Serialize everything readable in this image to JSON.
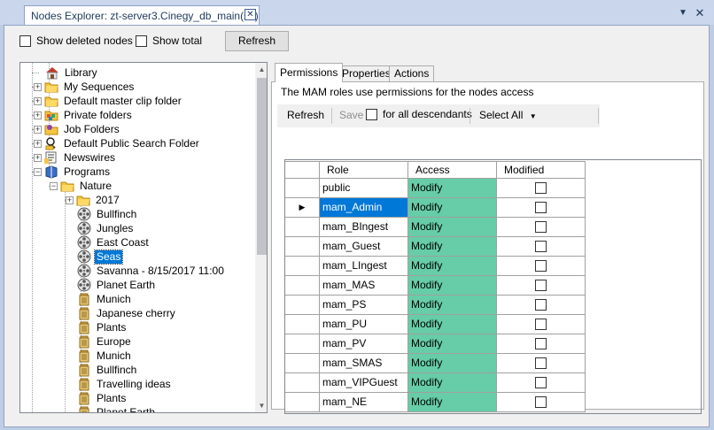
{
  "window": {
    "tab_title": "Nodes Explorer: zt-server3.Cinegy_db_main(sa)",
    "close_glyph": "✕",
    "menu_glyph": "▼",
    "window_close_glyph": "✕"
  },
  "top_bar": {
    "show_deleted_label": "Show deleted nodes",
    "show_total_label": "Show total",
    "refresh_label": "Refresh"
  },
  "tree": {
    "items": [
      {
        "label": "Library",
        "icon": "library-icon"
      },
      {
        "label": "My Sequences",
        "icon": "folder-icon"
      },
      {
        "label": "Default master clip folder",
        "icon": "folder-icon"
      },
      {
        "label": "Private folders",
        "icon": "private-folder-icon"
      },
      {
        "label": "Job Folders",
        "icon": "job-folder-icon"
      },
      {
        "label": "Default Public Search Folder",
        "icon": "search-folder-icon"
      },
      {
        "label": "Newswires",
        "icon": "newswire-icon"
      },
      {
        "label": "Programs",
        "icon": "programs-icon"
      },
      {
        "label": "Nature",
        "icon": "folder-open-icon"
      },
      {
        "label": "2017",
        "icon": "folder-icon"
      },
      {
        "label": "Bullfinch",
        "icon": "film-reel-icon"
      },
      {
        "label": "Jungles",
        "icon": "film-reel-icon"
      },
      {
        "label": "East Coast",
        "icon": "film-reel-icon"
      },
      {
        "label": "Seas",
        "icon": "film-reel-icon"
      },
      {
        "label": "Savanna - 8/15/2017 11:00",
        "icon": "film-reel-icon"
      },
      {
        "label": "Planet Earth",
        "icon": "film-reel-icon"
      },
      {
        "label": "Munich",
        "icon": "bin-icon"
      },
      {
        "label": "Japanese cherry",
        "icon": "bin-icon"
      },
      {
        "label": "Plants",
        "icon": "bin-icon"
      },
      {
        "label": "Europe",
        "icon": "bin-icon"
      },
      {
        "label": "Munich",
        "icon": "bin-icon"
      },
      {
        "label": "Bullfinch",
        "icon": "bin-icon"
      },
      {
        "label": "Travelling ideas",
        "icon": "bin-icon"
      },
      {
        "label": "Plants",
        "icon": "bin-icon"
      },
      {
        "label": "Planet Earth",
        "icon": "bin-icon"
      }
    ],
    "selected": "Seas"
  },
  "tabs": {
    "permissions": "Permissions",
    "properties": "Properties",
    "actions": "Actions"
  },
  "permissions": {
    "description": "The MAM roles use permissions for the nodes access",
    "toolbar": {
      "refresh": "Refresh",
      "save": "Save",
      "descendants": "for all descendants",
      "select_all": "Select All"
    },
    "columns": {
      "role": "Role",
      "access": "Access",
      "modified": "Modified"
    },
    "rows": [
      {
        "role": "public",
        "access": "Modify",
        "modified": false
      },
      {
        "role": "mam_Admin",
        "access": "Modify",
        "modified": false,
        "selected": true
      },
      {
        "role": "mam_BIngest",
        "access": "Modify",
        "modified": false
      },
      {
        "role": "mam_Guest",
        "access": "Modify",
        "modified": false
      },
      {
        "role": "mam_LIngest",
        "access": "Modify",
        "modified": false
      },
      {
        "role": "mam_MAS",
        "access": "Modify",
        "modified": false
      },
      {
        "role": "mam_PS",
        "access": "Modify",
        "modified": false
      },
      {
        "role": "mam_PU",
        "access": "Modify",
        "modified": false
      },
      {
        "role": "mam_PV",
        "access": "Modify",
        "modified": false
      },
      {
        "role": "mam_SMAS",
        "access": "Modify",
        "modified": false
      },
      {
        "role": "mam_VIPGuest",
        "access": "Modify",
        "modified": false
      },
      {
        "role": "mam_NE",
        "access": "Modify",
        "modified": false
      }
    ]
  },
  "colors": {
    "access_fill": "#66cda8",
    "selection": "#0078d7",
    "chrome": "#bfcde4"
  }
}
